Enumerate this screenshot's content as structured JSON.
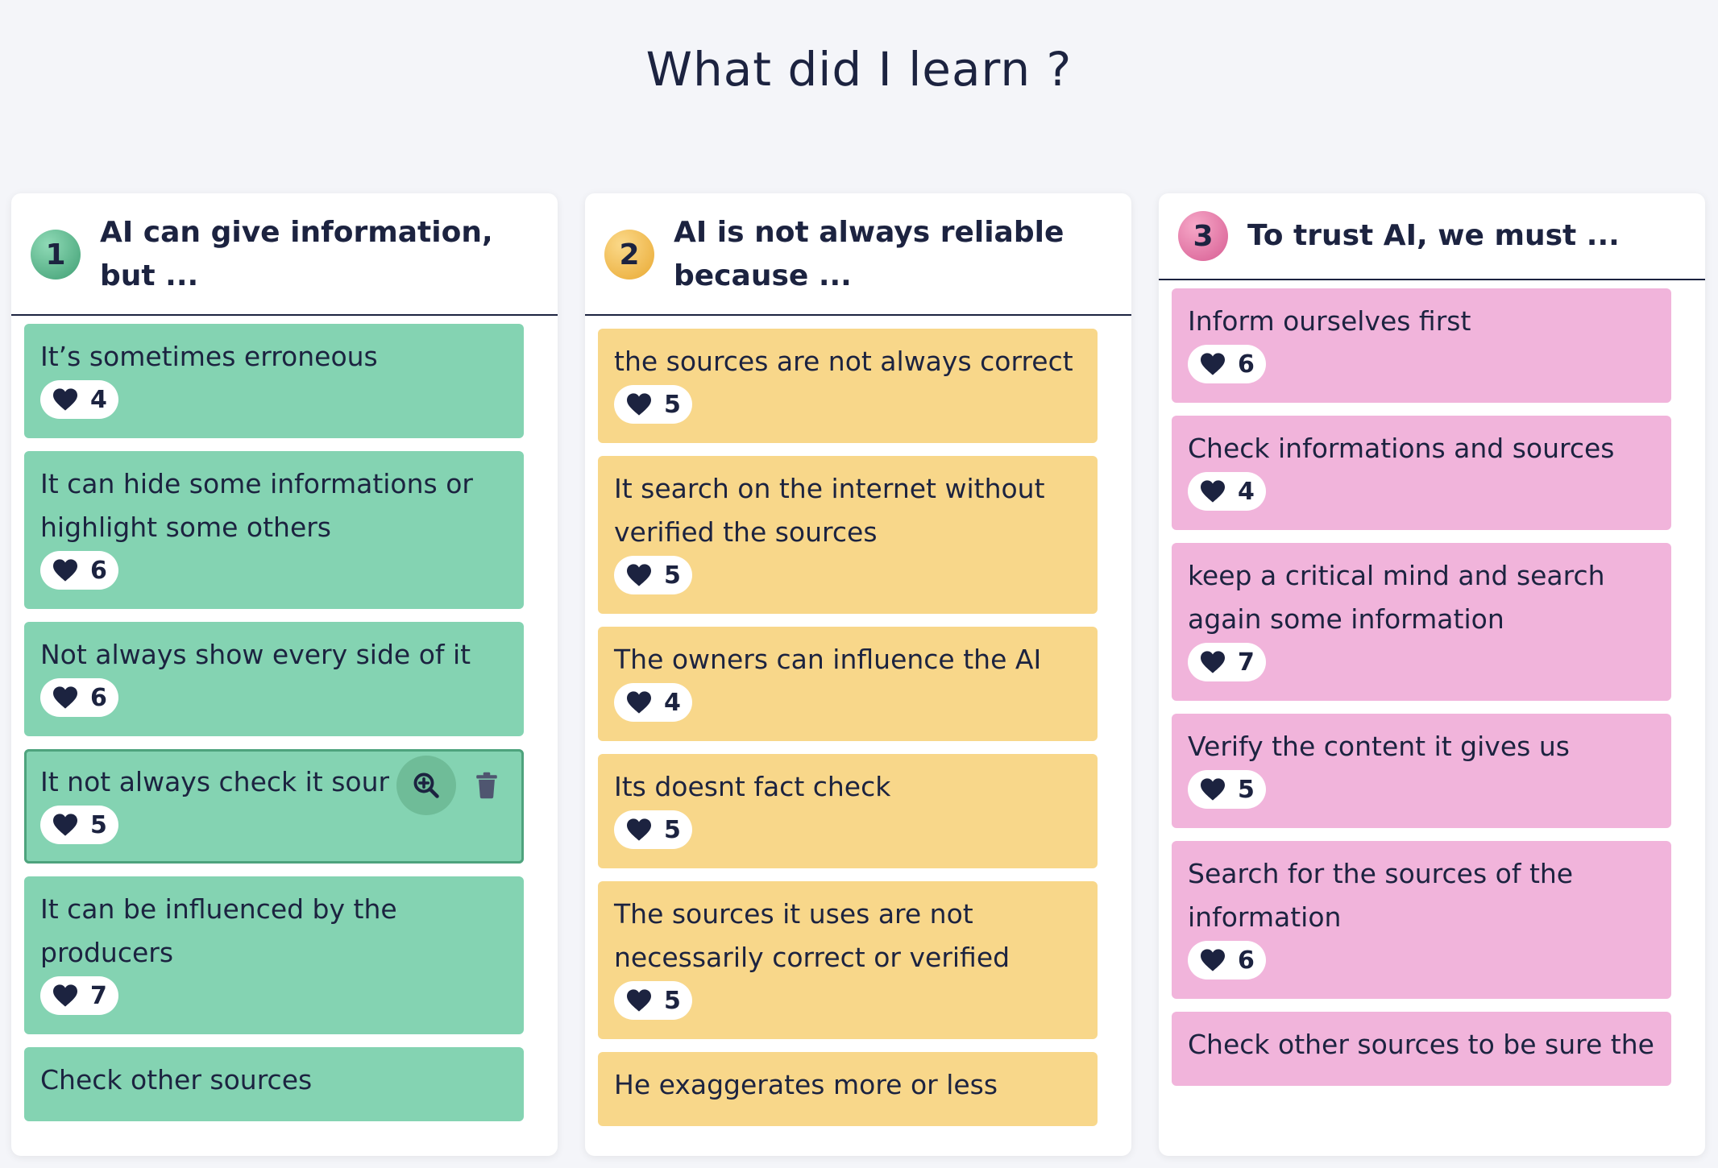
{
  "page": {
    "title": "What did I learn ?"
  },
  "colors": {
    "green": "#84d3b2",
    "yellow": "#f8d78a",
    "pink": "#f1b4db",
    "text": "#1c2340"
  },
  "columns": [
    {
      "number": "1",
      "title": "AI can give information, but ...",
      "cards": [
        {
          "text": "It’s sometimes erroneous",
          "likes": "4"
        },
        {
          "text": "It can hide some informations or highlight some others",
          "likes": "6"
        },
        {
          "text": "Not always show every side of it",
          "likes": "6"
        },
        {
          "text": "It not always check it sour",
          "likes": "5"
        },
        {
          "text": "It can be influenced by the producers",
          "likes": "7"
        },
        {
          "text": "Check other sources",
          "likes": ""
        }
      ]
    },
    {
      "number": "2",
      "title": "AI is not always reliable because ...",
      "cards": [
        {
          "text": "the sources are not always correct",
          "likes": "5"
        },
        {
          "text": "It search on the internet without verified the sources",
          "likes": "5"
        },
        {
          "text": "The owners can influence the AI",
          "likes": "4"
        },
        {
          "text": "Its doesnt fact check",
          "likes": "5"
        },
        {
          "text": "The sources it uses are not necessarily correct or verified",
          "likes": "5"
        },
        {
          "text": "He exaggerates more or less",
          "likes": ""
        }
      ]
    },
    {
      "number": "3",
      "title": "To trust AI, we must ...",
      "cards": [
        {
          "text": "Inform ourselves first",
          "likes": "6"
        },
        {
          "text": "Check informations and sources",
          "likes": "4"
        },
        {
          "text": "keep a critical mind and search again some information",
          "likes": "7"
        },
        {
          "text": "Verify the content it gives us",
          "likes": "5"
        },
        {
          "text": "Search for the sources of the information",
          "likes": "6"
        },
        {
          "text": "Check other sources to be sure the",
          "likes": ""
        }
      ]
    }
  ]
}
